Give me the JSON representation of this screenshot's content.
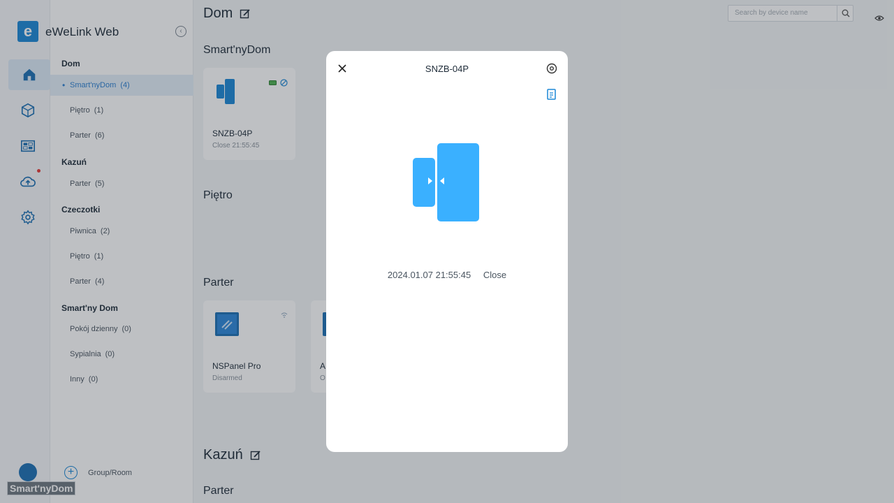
{
  "app": {
    "title": "eWeLink Web",
    "logo_letter": "e"
  },
  "rail": {
    "items": [
      {
        "icon": "home-icon"
      },
      {
        "icon": "scene-cube-icon"
      },
      {
        "icon": "dashboard-icon"
      },
      {
        "icon": "cloud-upload-icon"
      },
      {
        "icon": "settings-gear-icon"
      }
    ]
  },
  "sidebar": {
    "groups": [
      {
        "name": "Dom",
        "rooms": [
          {
            "label": "Smart'nyDom",
            "count": "(4)"
          },
          {
            "label": "Piętro",
            "count": "(1)"
          },
          {
            "label": "Parter",
            "count": "(6)"
          }
        ]
      },
      {
        "name": "Kazuń",
        "rooms": [
          {
            "label": "Parter",
            "count": "(5)"
          }
        ]
      },
      {
        "name": "Czeczotki",
        "rooms": [
          {
            "label": "Piwnica",
            "count": "(2)"
          },
          {
            "label": "Piętro",
            "count": "(1)"
          },
          {
            "label": "Parter",
            "count": "(4)"
          }
        ]
      },
      {
        "name": "Smart'ny Dom",
        "rooms": [
          {
            "label": "Pokój dzienny",
            "count": "(0)"
          },
          {
            "label": "Sypialnia",
            "count": "(0)"
          },
          {
            "label": "Inny",
            "count": "(0)"
          }
        ]
      }
    ],
    "add_label": "Group/Room",
    "watermark": "Smart'nyDom"
  },
  "main": {
    "title": "Dom",
    "search_placeholder": "Search by device name",
    "sections": {
      "s1": "Smart'nyDom",
      "s2": "Piętro",
      "s3": "Parter",
      "s4": "Kazuń",
      "s5": "Parter"
    },
    "cards": {
      "c1": {
        "name": "SNZB-04P",
        "status": "Close 21:55:45"
      },
      "c2": {
        "name": "NSPanel Pro",
        "status": "Disarmed"
      },
      "c3": {
        "name": "A",
        "status": "O"
      }
    }
  },
  "modal": {
    "title": "SNZB-04P",
    "event_time": "2024.01.07 21:55:45",
    "event_state": "Close"
  },
  "colors": {
    "accent": "#1b87d6",
    "sensor": "#3ab0ff"
  }
}
